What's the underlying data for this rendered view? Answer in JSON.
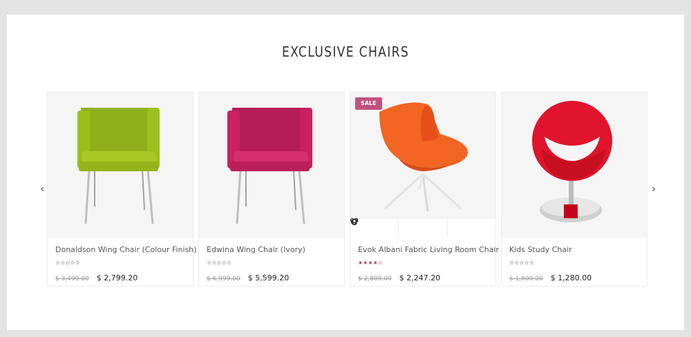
{
  "section": {
    "title": "EXCLUSIVE CHAIRS"
  },
  "carousel": {
    "prev_icon": "chevron-left-icon",
    "next_icon": "chevron-right-icon",
    "prev_glyph": "‹",
    "next_glyph": "›"
  },
  "products": [
    {
      "name": "Donaldson Wing Chair (Colour Finish)",
      "old_price": "$ 3,499.00",
      "price": "$ 2,799.20",
      "rating": 0,
      "badge": "",
      "color": "#9cbf1d"
    },
    {
      "name": "Edwina Wing Chair (Ivory)",
      "old_price": "$ 6,999.00",
      "price": "$ 5,599.20",
      "rating": 0,
      "badge": "",
      "color": "#c7215f"
    },
    {
      "name": "Evok Albani Fabric Living Room Chair",
      "old_price": "$ 2,809.00",
      "price": "$ 2,247.20",
      "rating": 4,
      "badge": "SALE",
      "color": "#f26522"
    },
    {
      "name": "Kids Study Chair",
      "old_price": "$ 1,600.00",
      "price": "$ 1,280.00",
      "rating": 0,
      "badge": "",
      "color": "#e0142c"
    }
  ],
  "card_actions": [
    {
      "icon": "eye-icon"
    },
    {
      "icon": "heart-icon"
    },
    {
      "icon": "refresh-icon"
    }
  ],
  "colors": {
    "accent": "#c0527e",
    "star": "#a8436e",
    "background": "#e3e3e3"
  }
}
